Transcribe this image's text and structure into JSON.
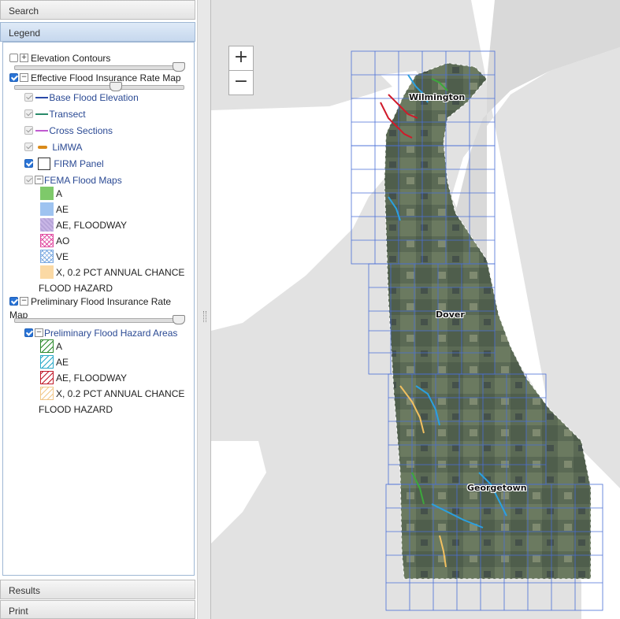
{
  "panel": {
    "search_label": "Search",
    "legend_label": "Legend",
    "results_label": "Results",
    "print_label": "Print"
  },
  "legend": {
    "elevation_contours": "Elevation Contours",
    "effective_firm": "Effective Flood Insurance Rate Map",
    "bfe": "Base Flood Elevation",
    "transect": "Transect",
    "cross_sections": "Cross Sections",
    "limwa": "LiMWA",
    "firm_panel": "FIRM Panel",
    "fema_flood_maps": "FEMA Flood Maps",
    "eff_items": [
      "A",
      "AE",
      "AE, FLOODWAY",
      "AO",
      "VE",
      "X, 0.2 PCT ANNUAL CHANCE",
      "FLOOD HAZARD"
    ],
    "prelim_firm_line1": "Preliminary Flood Insurance Rate",
    "prelim_firm_line2": "Map",
    "prelim_hazard_areas": "Preliminary Flood Hazard Areas",
    "pre_items": [
      "A",
      "AE",
      "AE, FLOODWAY",
      "X, 0.2 PCT ANNUAL CHANCE",
      "FLOOD HAZARD"
    ]
  },
  "map": {
    "zoom_in": "+",
    "zoom_out": "−",
    "cities": [
      "Wilmington",
      "Dover",
      "Georgetown"
    ]
  },
  "colors": {
    "bfe": "#2b4aa8",
    "transect": "#2a8a6a",
    "cross_sections": "#c05ad0",
    "limwa": "#d98a1a",
    "zone_a": "#7ec96a",
    "zone_ae": "#9ec3f0",
    "grid": "#4a6fd6"
  }
}
